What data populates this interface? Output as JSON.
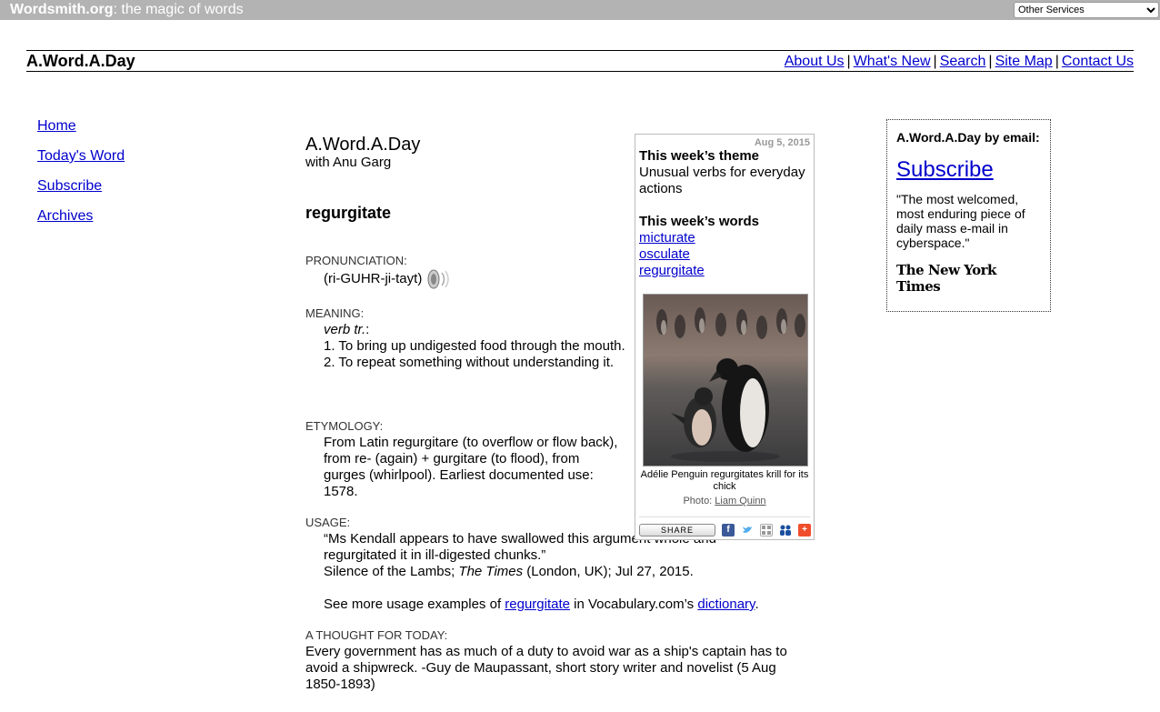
{
  "topbar": {
    "brand_bold": "Wordsmith.org",
    "brand_rest": ": the magic of words",
    "services_selected": "Other Services"
  },
  "header": {
    "title": "A.Word.A.Day",
    "nav": [
      "About Us",
      "What's New",
      "Search",
      "Site Map",
      "Contact Us"
    ]
  },
  "leftnav": [
    "Home",
    "Today's Word",
    "Subscribe",
    "Archives"
  ],
  "main": {
    "heading": "A.Word.A.Day",
    "byline": "with Anu Garg",
    "word": "regurgitate",
    "pron_label": "PRONUNCIATION:",
    "pron": "(ri-GUHR-ji-tayt)",
    "meaning_label": "MEANING:",
    "pos": "verb tr.",
    "pos_suffix": ":",
    "def1": "1. To bring up undigested food through the mouth.",
    "def2": "2. To repeat something without understanding it.",
    "etym_label": "ETYMOLOGY:",
    "etym": "From Latin regurgitare (to overflow or flow back), from re- (again) + gurgitare (to flood), from gurges (whirlpool). Earliest documented use: 1578.",
    "usage_label": "USAGE:",
    "usage_quote": "“Ms Kendall appears to have swallowed this argument whole and regurgitated it in ill-digested chunks.”",
    "usage_src_a": "Silence of the Lambs; ",
    "usage_src_pub": "The Times",
    "usage_src_b": " (London, UK); Jul 27, 2015.",
    "more_a": "See more usage examples of ",
    "more_link": "regurgitate",
    "more_b": " in Vocabulary.com’s ",
    "more_link2": "dictionary",
    "more_c": ".",
    "thought_label": "A THOUGHT FOR TODAY:",
    "thought": "Every government has as much of a duty to avoid war as a ship's captain has to avoid a shipwreck. -Guy de Maupassant, short story writer and novelist (5 Aug 1850-1893)"
  },
  "theme": {
    "date": "Aug 5, 2015",
    "theme_heading": "This week’s theme",
    "theme_text": "Unusual verbs for everyday actions",
    "words_heading": "This week’s words",
    "words": [
      "micturate",
      "osculate",
      "regurgitate"
    ],
    "caption": "Adélie Penguin regurgitates krill for its chick",
    "photo_label": "Photo: ",
    "photo_credit": "Liam Quinn",
    "share": "SHARE"
  },
  "email": {
    "title": "A.Word.A.Day by email:",
    "subscribe": "Subscribe",
    "quote": "\"The most welcomed, most enduring piece of daily mass e-mail in cyberspace.\"",
    "source": "The New York Times"
  },
  "colors": {
    "link": "#0000cc",
    "topbar": "#b3b3b3"
  }
}
